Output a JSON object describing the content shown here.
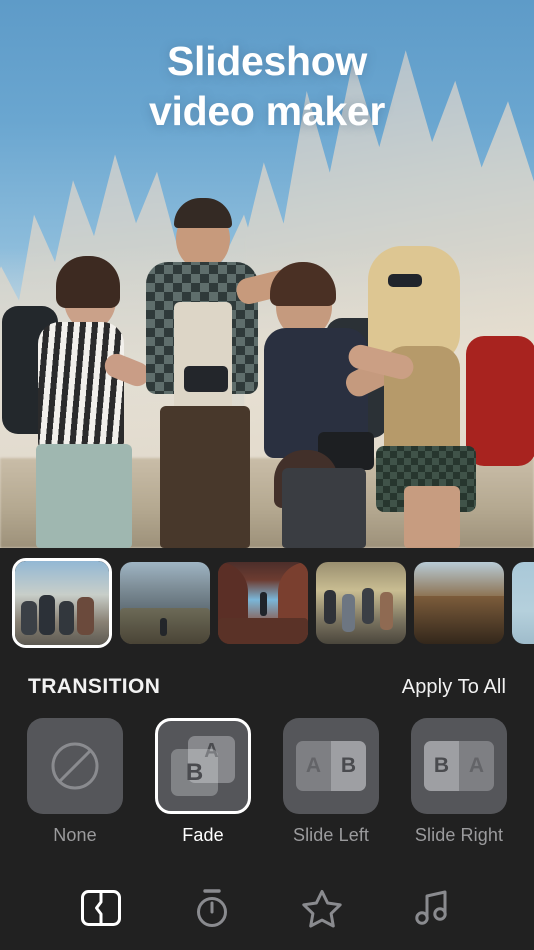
{
  "app": {
    "theme_background": "#212121",
    "tile_background": "#55565a",
    "accent": "#ffffff",
    "muted_text": "#9b9b9d"
  },
  "preview": {
    "title_line1": "Slideshow",
    "title_line2": "video maker",
    "title_color": "#ffffff",
    "image_alt": "four young hikers laughing together on a rocky mountain pass"
  },
  "thumbnail_strip": {
    "name": "slide-thumbnails",
    "selected_index": 0,
    "items": [
      {
        "label": "Slide 1",
        "scene": "group of hikers in the dolomites",
        "scene_class": "sc-group"
      },
      {
        "label": "Slide 2",
        "scene": "hiker at a wide canyon overlook",
        "scene_class": "sc-canyon"
      },
      {
        "label": "Slide 3",
        "scene": "hiker silhouetted inside a red rock arch",
        "scene_class": "sc-arch"
      },
      {
        "label": "Slide 4",
        "scene": "group walking a sunlit desert trail",
        "scene_class": "sc-trail"
      },
      {
        "label": "Slide 5",
        "scene": "red canyon cliffs at dusk",
        "scene_class": "sc-zion"
      },
      {
        "label": "Slide 6",
        "scene": "pale blue sky",
        "scene_class": "sc-sky"
      }
    ]
  },
  "transition_panel": {
    "section_title": "TRANSITION",
    "apply_to_all_label": "Apply To All",
    "selected_option": "Fade",
    "options": [
      {
        "label": "None",
        "icon": "circle-slash-icon",
        "selected": false
      },
      {
        "label": "Fade",
        "icon": "fade-cards-icon",
        "selected": true,
        "card_front": "B",
        "card_back": "A"
      },
      {
        "label": "Slide Left",
        "icon": "slide-left-icon",
        "selected": false,
        "frame_left": "A",
        "frame_right": "B"
      },
      {
        "label": "Slide Right",
        "icon": "slide-right-icon",
        "selected": false,
        "frame_left": "B",
        "frame_right": "A"
      }
    ]
  },
  "tabbar": {
    "selected": "transition",
    "items": [
      {
        "key": "transition",
        "label": "Transition",
        "icon": "transition-icon",
        "selected": true
      },
      {
        "key": "duration",
        "label": "Duration",
        "icon": "stopwatch-icon",
        "selected": false
      },
      {
        "key": "effects",
        "label": "Effects",
        "icon": "star-icon",
        "selected": false
      },
      {
        "key": "music",
        "label": "Music",
        "icon": "music-note-icon",
        "selected": false
      }
    ]
  }
}
